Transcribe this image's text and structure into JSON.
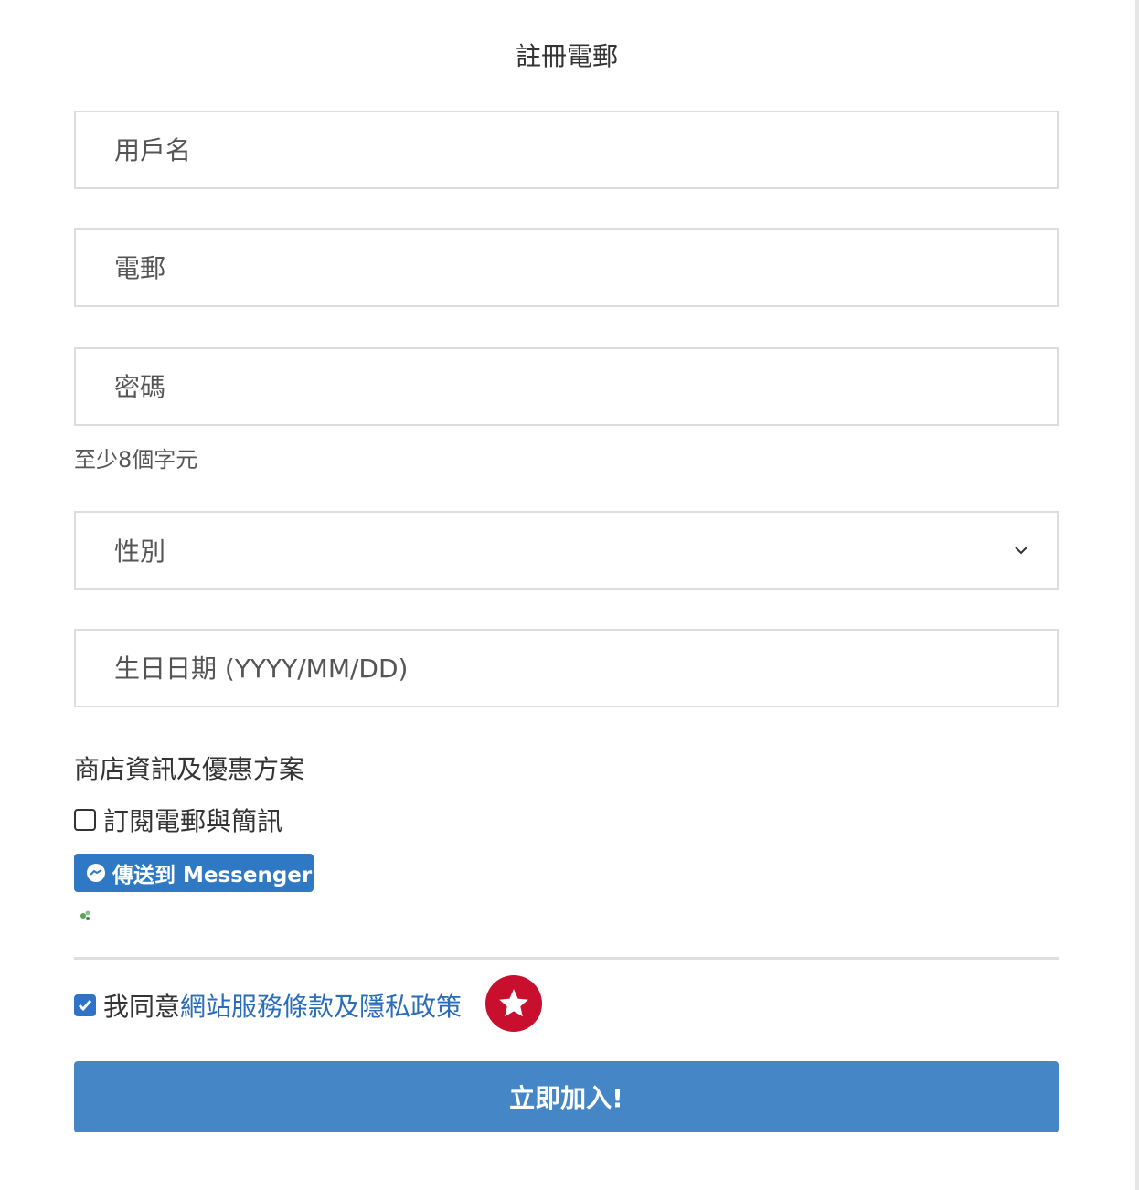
{
  "form": {
    "title": "註冊電郵",
    "username_placeholder": "用戶名",
    "email_placeholder": "電郵",
    "password_placeholder": "密碼",
    "password_hint": "至少8個字元",
    "gender_placeholder": "性別",
    "birthday_placeholder": "生日日期 (YYYY/MM/DD)"
  },
  "marketing": {
    "section_title": "商店資訊及優惠方案",
    "subscribe_label": "訂閱電郵與簡訊",
    "subscribe_checked": false,
    "messenger_button": "傳送到 Messenger",
    "messenger_icon": "messenger-icon"
  },
  "terms": {
    "prefix": "我同意",
    "link_text": "網站服務條款及隱私政策",
    "checked": true,
    "badge_icon": "star-icon",
    "badge_color": "#c8102e"
  },
  "submit_label": "立即加入!",
  "colors": {
    "primary": "#4486c6",
    "messenger": "#2f78c4",
    "link": "#2a6cb8"
  }
}
